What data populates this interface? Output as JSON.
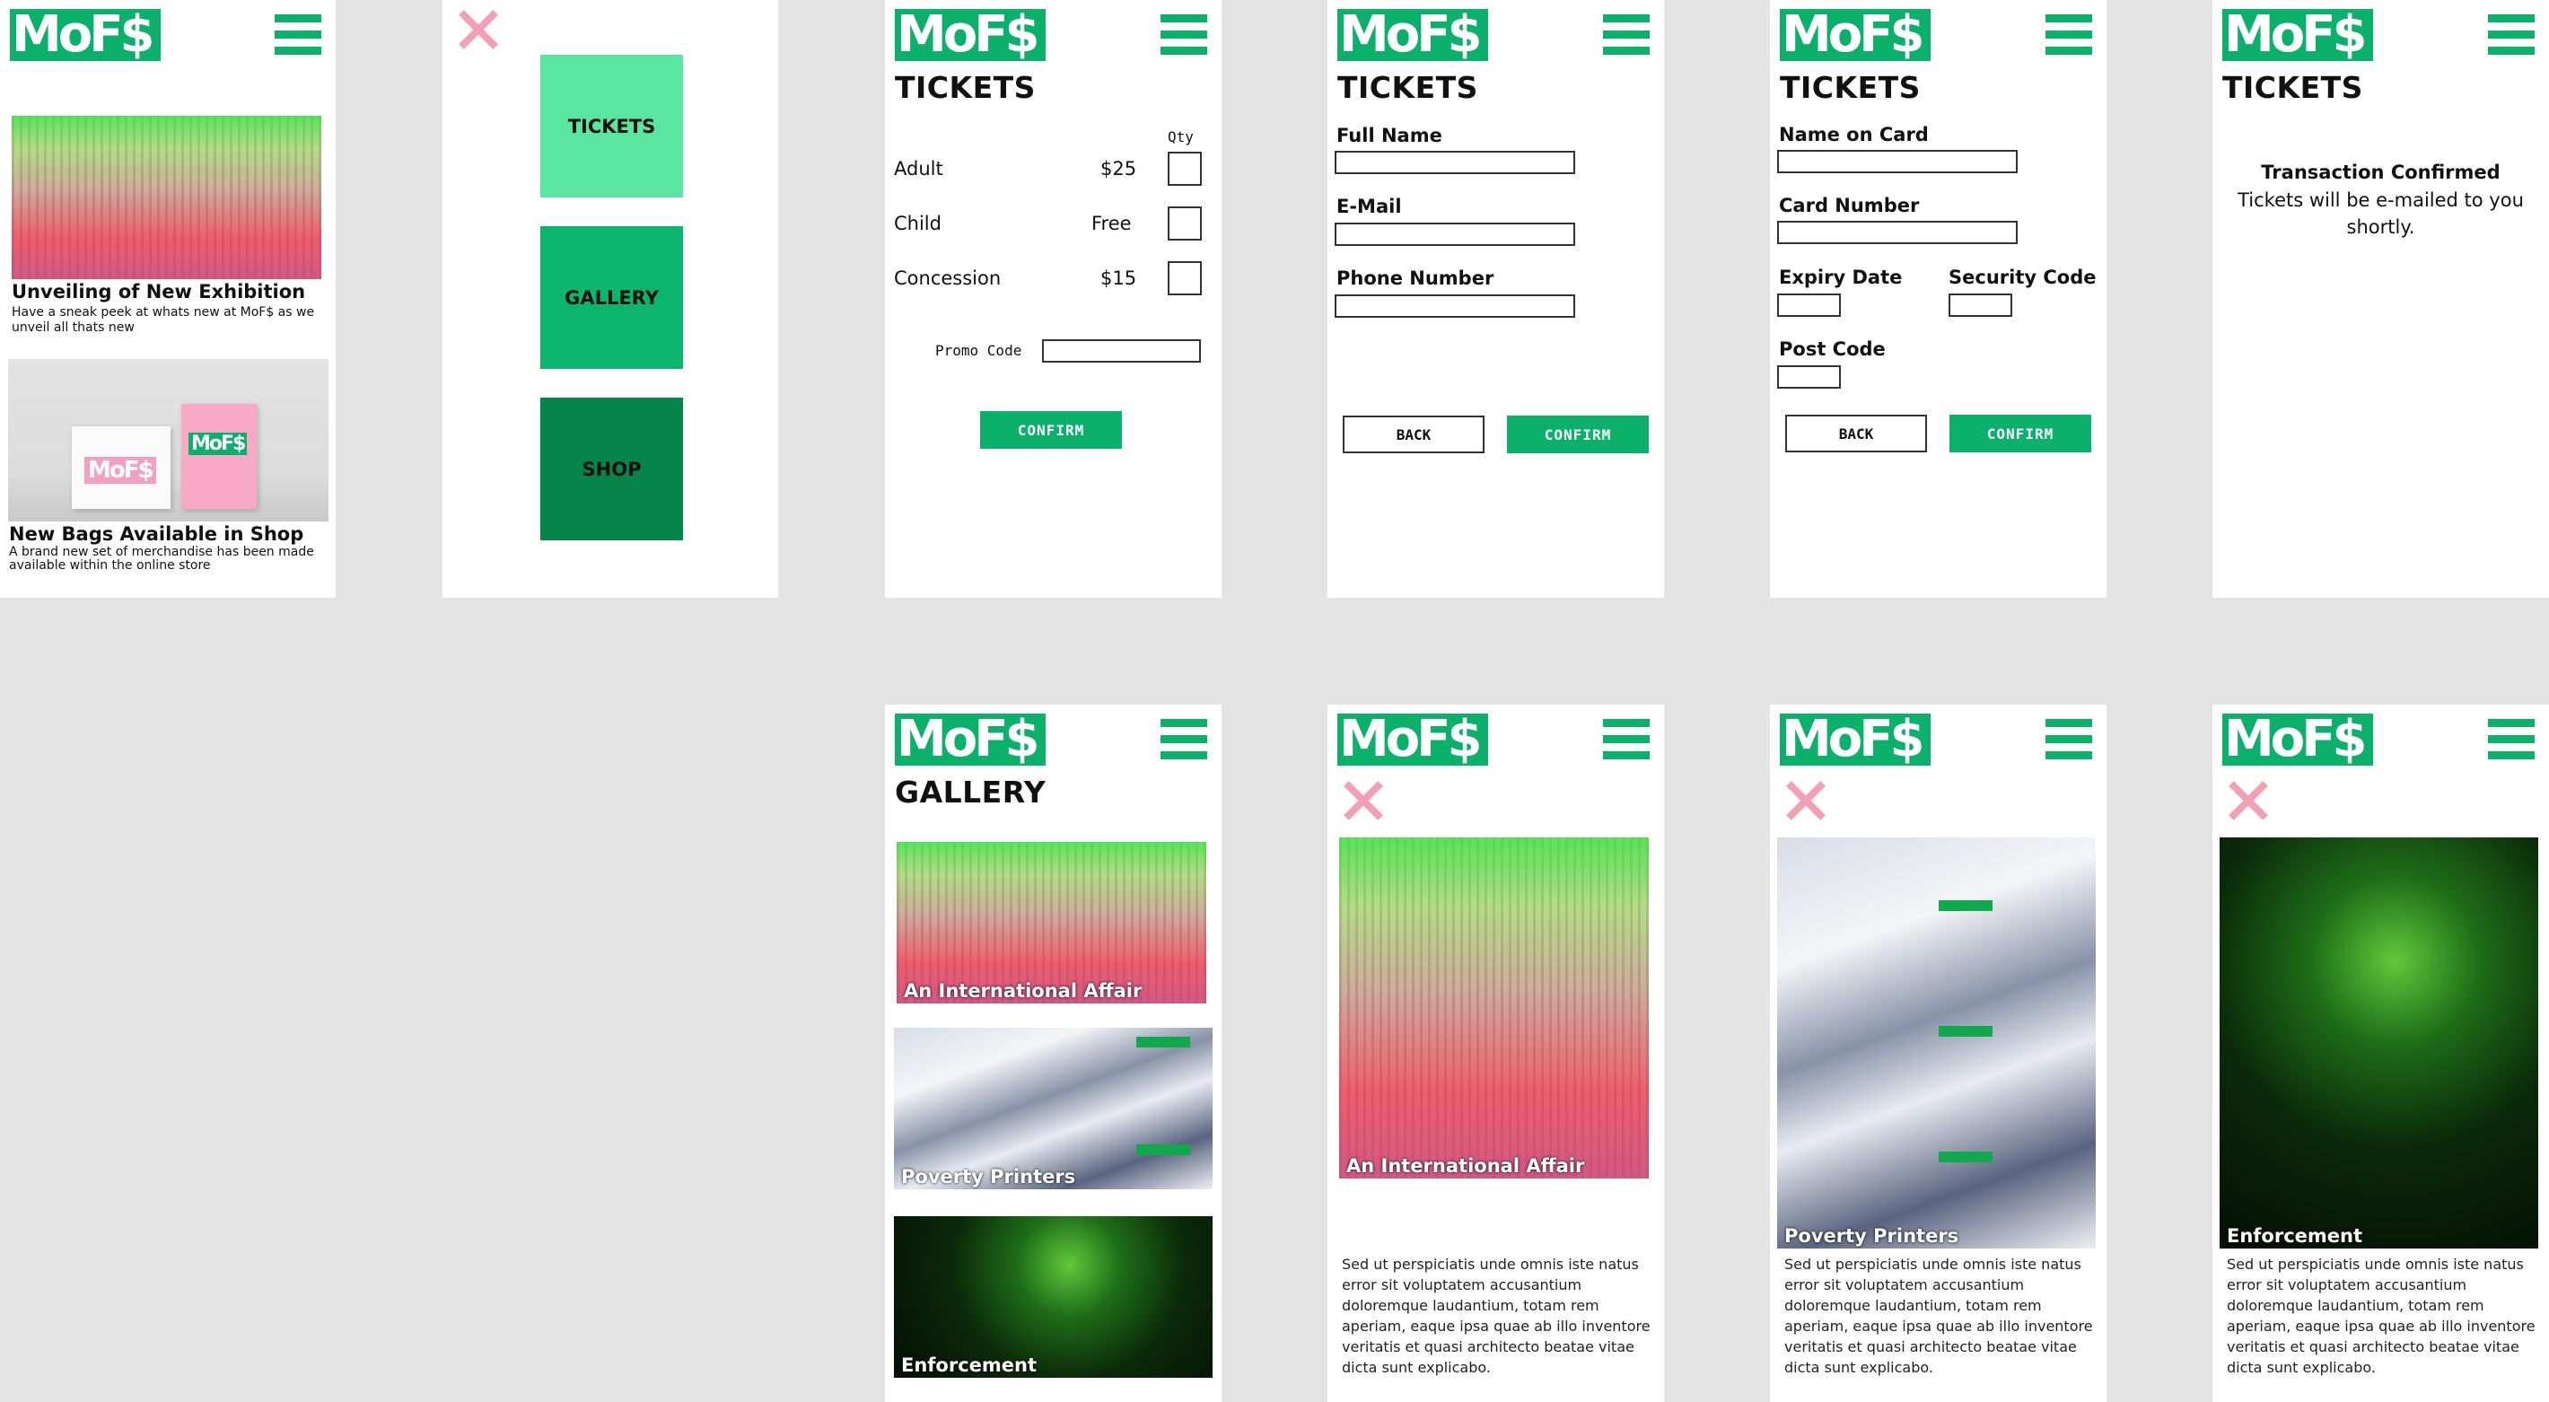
{
  "brand": {
    "logo_text": "MoF$",
    "accent": "#0bb06a",
    "close_color": "#f4a0b4"
  },
  "home": {
    "articles": [
      {
        "title": "Unveiling of New Exhibition",
        "blurb": "Have a sneak peek at whats new at MoF$ as we unveil all thats new"
      },
      {
        "title": "New Bags Available in Shop",
        "blurb": "A brand new set of merchandise has been made available within the online store"
      }
    ],
    "bag_logo": "MoF$"
  },
  "menu": {
    "items": [
      "TICKETS",
      "GALLERY",
      "SHOP"
    ],
    "colors": [
      "#5ae6a0",
      "#0bb56c",
      "#07844a"
    ]
  },
  "tickets_select": {
    "title": "TICKETS",
    "qty_label": "Qty",
    "rows": [
      {
        "type": "Adult",
        "price": "$25"
      },
      {
        "type": "Child",
        "price": "Free"
      },
      {
        "type": "Concession",
        "price": "$15"
      }
    ],
    "promo_label": "Promo Code",
    "confirm": "CONFIRM"
  },
  "tickets_details": {
    "title": "TICKETS",
    "fields": [
      "Full Name",
      "E-Mail",
      "Phone Number"
    ],
    "back": "BACK",
    "confirm": "CONFIRM"
  },
  "tickets_payment": {
    "title": "TICKETS",
    "name_on_card": "Name on Card",
    "card_number": "Card Number",
    "expiry": "Expiry Date",
    "security": "Security Code",
    "post_code": "Post Code",
    "back": "BACK",
    "confirm": "CONFIRM"
  },
  "tickets_done": {
    "title": "TICKETS",
    "heading": "Transaction Confirmed",
    "message": "Tickets will be e-mailed to you shortly."
  },
  "gallery": {
    "title": "GALLERY",
    "items": [
      "An International Affair",
      "Poverty Printers",
      "Enforcement"
    ]
  },
  "detail": {
    "body": "Sed ut perspiciatis unde omnis iste natus error sit voluptatem accusantium doloremque laudantium, totam rem aperiam, eaque ipsa quae ab illo inventore veritatis et quasi architecto beatae vitae dicta sunt explicabo.",
    "captions": [
      "An International Affair",
      "Poverty Printers",
      "Enforcement"
    ]
  }
}
